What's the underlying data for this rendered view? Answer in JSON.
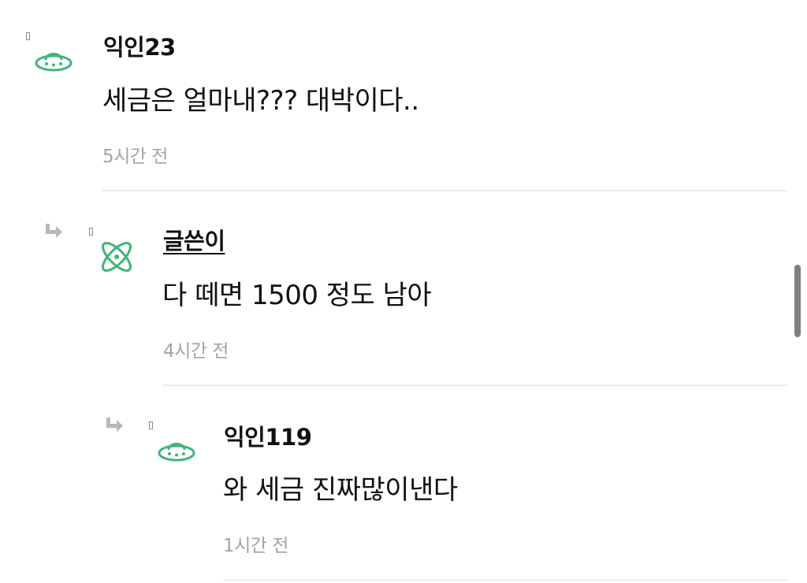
{
  "comments": [
    {
      "nickname": "익인23",
      "content": "세금은 얼마내??? 대박이다..",
      "time": "5시간 전",
      "avatar_icon": "ufo-icon",
      "is_author": false
    },
    {
      "nickname": "글쓴이",
      "content": "다 떼면 1500 정도 남아",
      "time": "4시간 전",
      "avatar_icon": "atom-icon",
      "is_author": true
    },
    {
      "nickname": "익인119",
      "content": "와 세금 진짜많이낸다",
      "time": "1시간 전",
      "avatar_icon": "ufo-icon",
      "is_author": false
    }
  ],
  "colors": {
    "avatar_green": "#3fb57a",
    "time_gray": "#a3a3a3",
    "divider": "#ececec"
  }
}
